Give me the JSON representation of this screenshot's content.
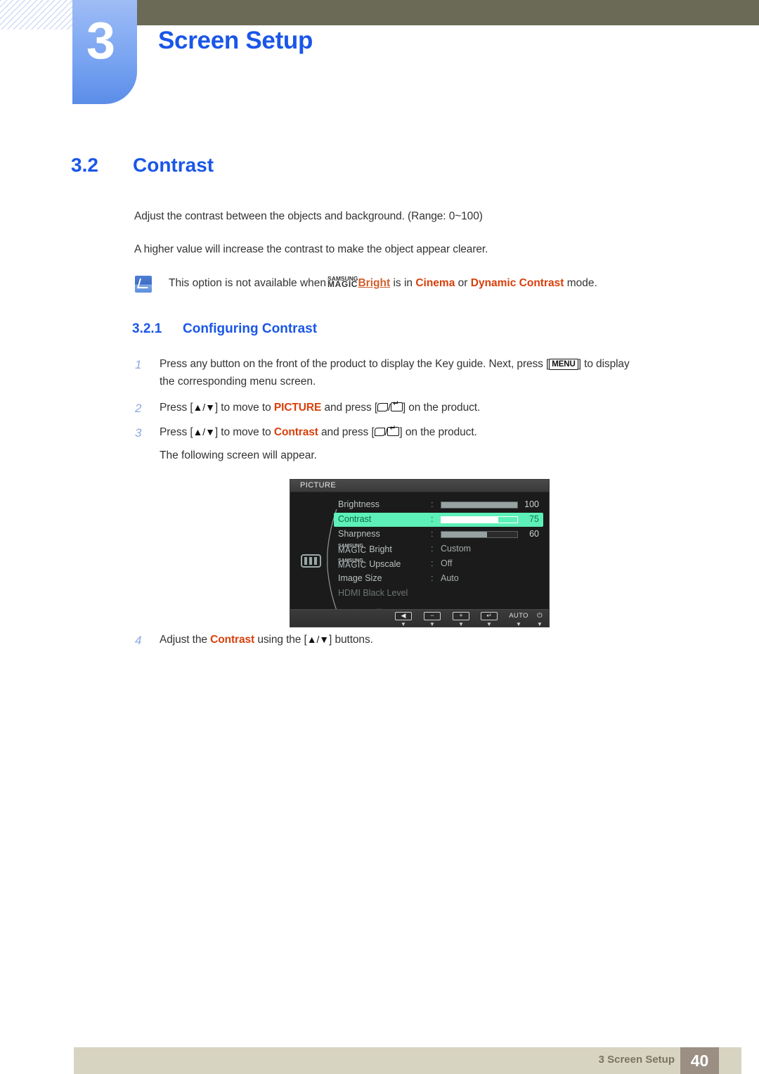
{
  "header": {
    "chapter_number": "3",
    "chapter_title": "Screen Setup"
  },
  "section": {
    "number": "3.2",
    "title": "Contrast"
  },
  "body": {
    "paragraph_1": "Adjust the contrast between the objects and background. (Range: 0~100)",
    "paragraph_2": "A higher value will increase the contrast to make the object appear clearer."
  },
  "note": {
    "icon": "note-pen-icon",
    "text_before": "This option is not available when",
    "magic_top": "SAMSUNG",
    "magic_bottom": "MAGIC",
    "magic_suffix": "Bright",
    "text_mid": "is in",
    "mode_1": "Cinema",
    "text_or": "or",
    "mode_2": "Dynamic Contrast",
    "text_after": "mode."
  },
  "subsection": {
    "number": "3.2.1",
    "title": "Configuring Contrast"
  },
  "steps": {
    "one": {
      "number": "1",
      "line_1_a": "Press any button on the front of the product to display the Key guide. Next, press [",
      "keycap": "MENU",
      "line_1_b": "] to display",
      "line_2": "the corresponding menu screen."
    },
    "two": {
      "number": "2",
      "a": "Press [",
      "arrows": "▲/▼",
      "b": "] to move to",
      "highlight": "PICTURE",
      "c": "and press [",
      "d": "] on the product."
    },
    "three": {
      "number": "3",
      "a": "Press [",
      "arrows": "▲/▼",
      "b": "] to move to",
      "highlight": "Contrast",
      "c": "and press [",
      "d": "] on the product.",
      "follow": "The following screen will appear."
    },
    "four": {
      "number": "4",
      "a": "Adjust the",
      "highlight": "Contrast",
      "b": "using the [",
      "arrows": "▲/▼",
      "c": "] buttons."
    }
  },
  "osd": {
    "title": "PICTURE",
    "category_icon": "picture-bars-icon",
    "rows": [
      {
        "label": "Brightness",
        "colon": ":",
        "type": "slider",
        "value": "100",
        "fill_pct": 100
      },
      {
        "label": "Contrast",
        "colon": ":",
        "type": "slider",
        "value": "75",
        "fill_pct": 75,
        "selected": true
      },
      {
        "label": "Sharpness",
        "colon": ":",
        "type": "slider",
        "value": "60",
        "fill_pct": 60
      },
      {
        "label_magic_top": "SAMSUNG",
        "label_magic_bottom": "MAGIC",
        "label_suffix": "Bright",
        "colon": ":",
        "type": "value",
        "value": "Custom"
      },
      {
        "label_magic_top": "SAMSUNG",
        "label_magic_bottom": "MAGIC",
        "label_suffix": "Upscale",
        "colon": ":",
        "type": "value",
        "value": "Off"
      },
      {
        "label": "Image Size",
        "colon": ":",
        "type": "value",
        "value": "Auto"
      },
      {
        "label": "HDMI Black Level",
        "type": "dim"
      }
    ],
    "scroll_arrow": "▼",
    "footer_buttons": [
      {
        "icon": "left-arrow-icon",
        "glyph": "◀",
        "kind": "icon"
      },
      {
        "icon": "minus-icon",
        "glyph": "−",
        "kind": "icon"
      },
      {
        "icon": "plus-icon",
        "glyph": "+",
        "kind": "icon"
      },
      {
        "icon": "enter-return-icon",
        "glyph": "↵",
        "kind": "icon"
      },
      {
        "icon": "auto-label",
        "glyph": "AUTO",
        "kind": "text"
      },
      {
        "icon": "power-icon",
        "glyph": "⏻",
        "kind": "text"
      }
    ],
    "footer_down_arrow": "▼",
    "colors": {
      "selected_row": "#5df0b8",
      "selected_text": "#0c6b46",
      "bar_fill": "#97a2a2",
      "label": "#b9c0c0"
    }
  },
  "footer": {
    "label": "3 Screen Setup",
    "page_number": "40"
  },
  "colors": {
    "heading_blue": "#1a56e8",
    "highlight_orange": "#d93f0b",
    "header_bar": "#6b6a56",
    "footer_bar": "#d8d4c2",
    "page_box": "#9b8f83"
  }
}
